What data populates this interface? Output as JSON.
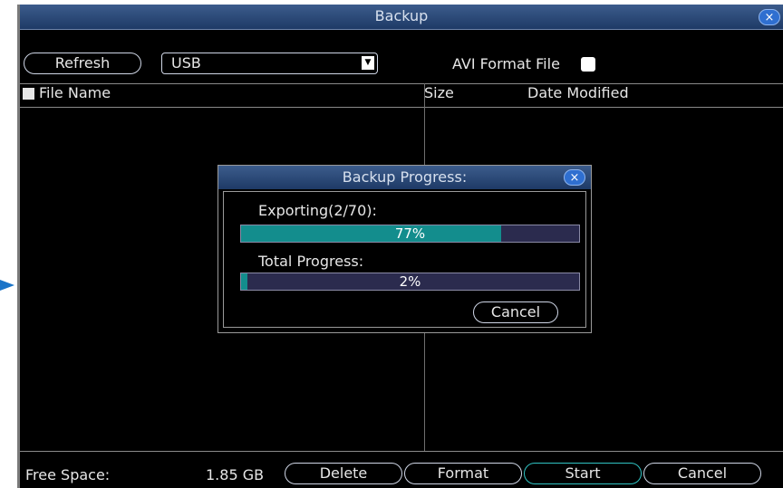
{
  "window": {
    "title": "Backup",
    "close_icon": "×"
  },
  "toolbar": {
    "refresh_label": "Refresh",
    "device_select_value": "USB",
    "avi_label": "AVI Format File",
    "avi_checked": false
  },
  "table": {
    "columns": [
      "File Name",
      "Size",
      "Date Modified"
    ],
    "rows": []
  },
  "footer": {
    "free_space_label": "Free Space:",
    "free_space_value": "1.85 GB",
    "delete_label": "Delete",
    "format_label": "Format",
    "start_label": "Start",
    "cancel_label": "Cancel"
  },
  "progress_dialog": {
    "title": "Backup Progress:",
    "close_icon": "×",
    "export_label": "Exporting(2/70):",
    "export_percent_text": "77%",
    "export_progress": 0.77,
    "total_label": "Total Progress:",
    "total_percent_text": "2%",
    "total_progress": 0.02,
    "cancel_label": "Cancel"
  },
  "colors": {
    "titlebar": "#2a4a7a",
    "progress_fill": "#138d8d",
    "progress_track": "#2b2b4e",
    "accent_border": "#2fc3c3"
  }
}
